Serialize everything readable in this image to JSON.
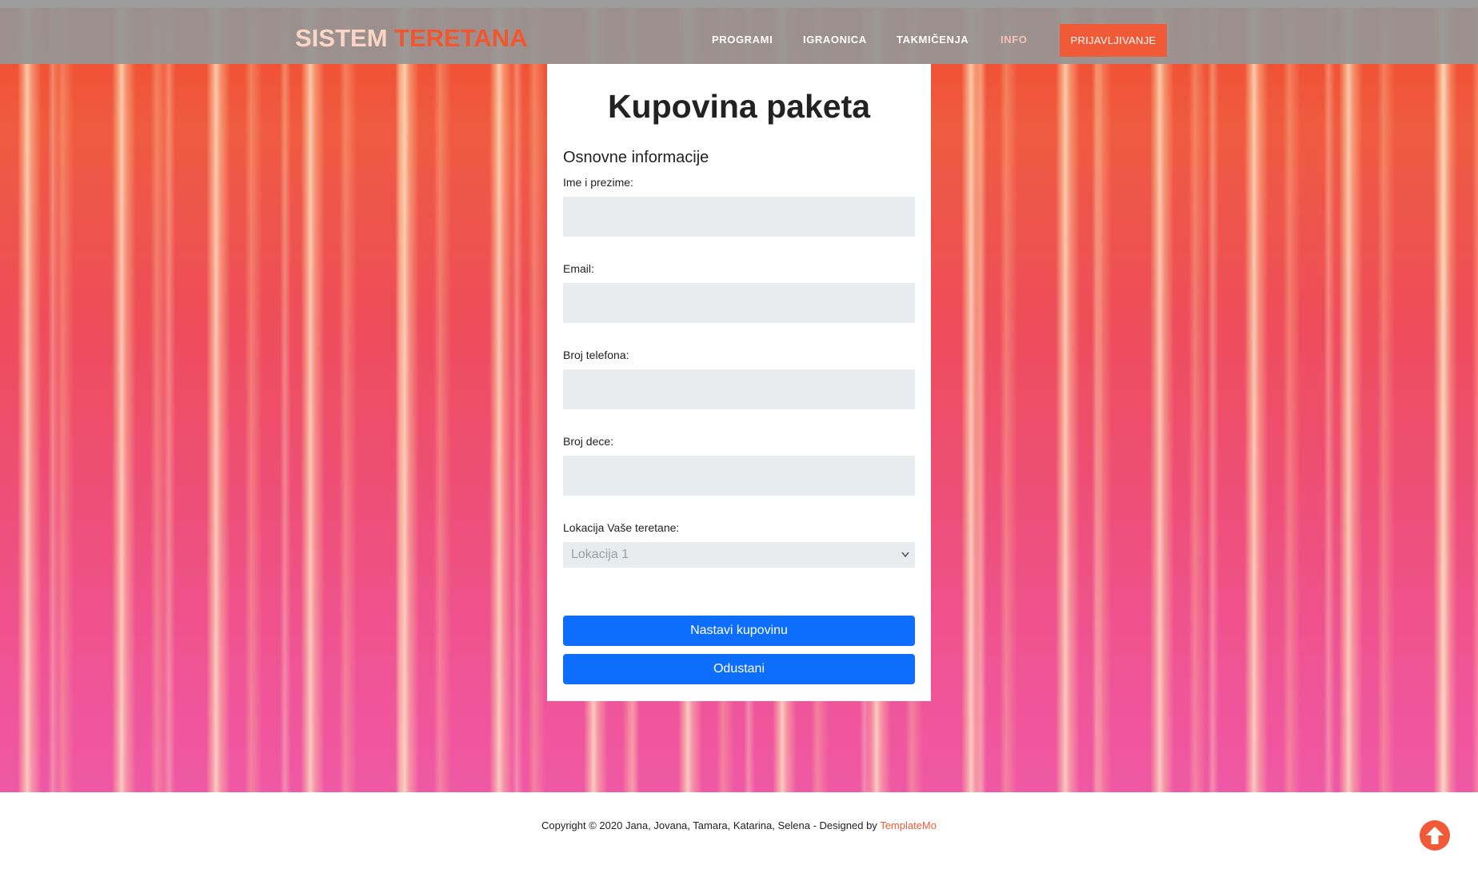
{
  "brand": {
    "part1": "SISTEM",
    "part2": "TERETANA"
  },
  "nav": {
    "links": [
      "PROGRAMI",
      "IGRAONICA",
      "TAKMIČENJA",
      "INFO"
    ],
    "login_button": "PRIJAVLJIVANJE"
  },
  "form": {
    "title": "Kupovina paketa",
    "section": "Osnovne informacije",
    "fields": [
      {
        "label": "Ime i prezime:",
        "value": ""
      },
      {
        "label": "Email:",
        "value": ""
      },
      {
        "label": "Broj telefona:",
        "value": ""
      },
      {
        "label": "Broj dece:",
        "value": ""
      }
    ],
    "location_label": "Lokacija Vaše teretane:",
    "location_selected": "Lokacija 1",
    "continue_button": "Nastavi kupovinu",
    "cancel_button": "Odustani"
  },
  "footer": {
    "copyright": "Copyright © 2020 Jana, Jovana, Tamara, Katarina, Selena - Designed by",
    "designer_link": "TemplateMo"
  },
  "icons": {
    "scroll_top": "arrow-up-circle-icon",
    "select_chevron": "chevron-down-icon"
  },
  "colors": {
    "accent": "#f15a36",
    "primary_button": "#0d6efd",
    "input_bg": "#e8ecee"
  }
}
